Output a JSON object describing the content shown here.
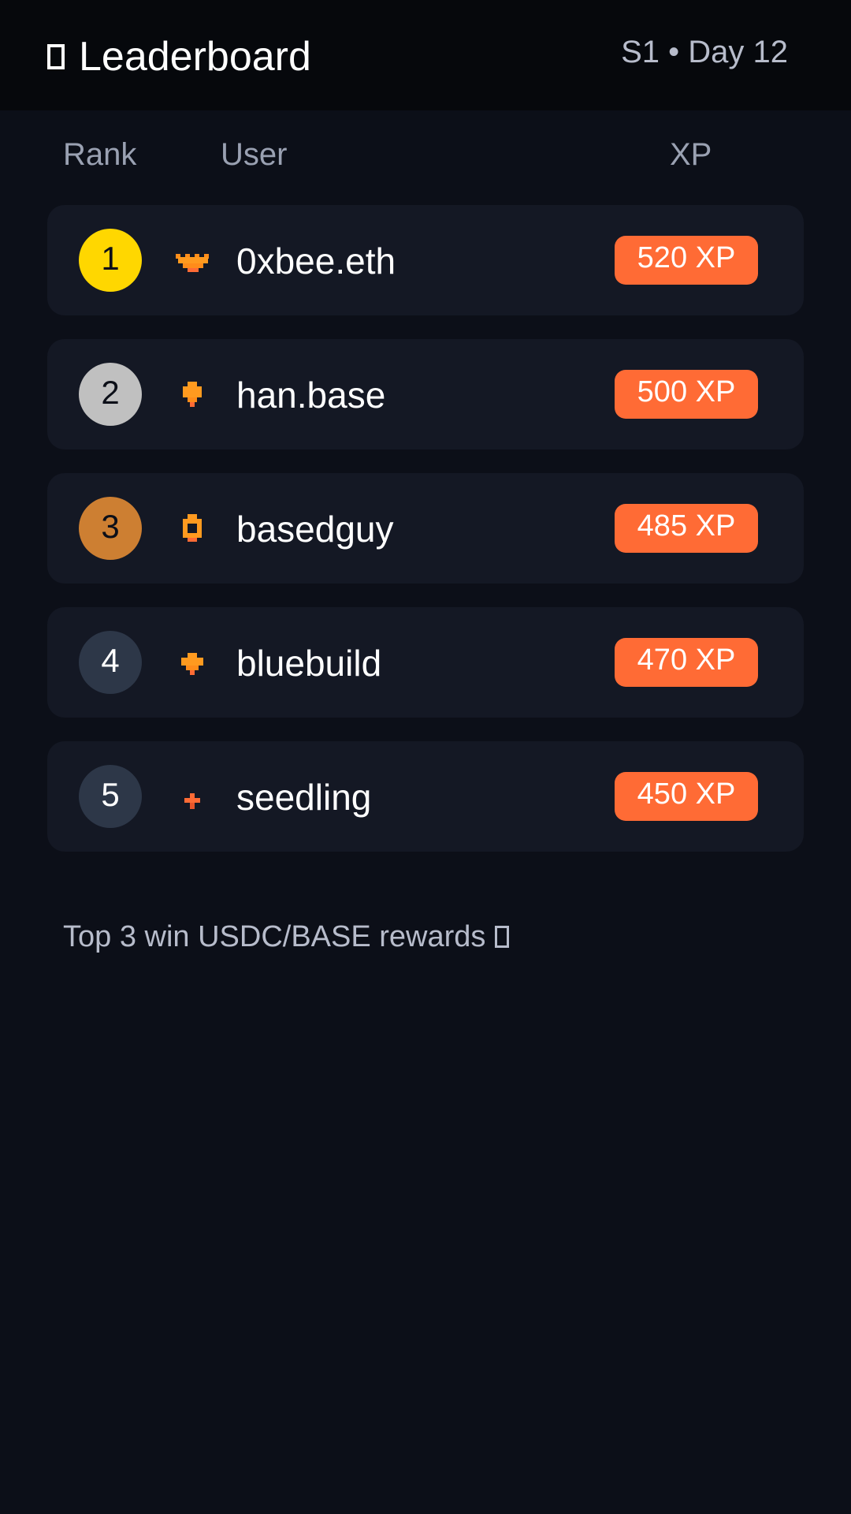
{
  "header": {
    "title": "Leaderboard",
    "title_icon": "trophy-icon",
    "season": "S1 • Day 12"
  },
  "columns": {
    "rank": "Rank",
    "user": "User",
    "xp": "XP"
  },
  "colors": {
    "accent": "#ff6b35",
    "gold": "#ffd700",
    "silver": "#c0c0c0",
    "bronze": "#cd7f32",
    "neutral_rank": "#2d3748"
  },
  "rows": [
    {
      "rank": "1",
      "avatar_icon": "crown-icon",
      "username": "0xbee.eth",
      "xp": "520 XP"
    },
    {
      "rank": "2",
      "avatar_icon": "diamond-icon",
      "username": "han.base",
      "xp": "500 XP"
    },
    {
      "rank": "3",
      "avatar_icon": "ring-icon",
      "username": "basedguy",
      "xp": "485 XP"
    },
    {
      "rank": "4",
      "avatar_icon": "gem-icon",
      "username": "bluebuild",
      "xp": "470 XP"
    },
    {
      "rank": "5",
      "avatar_icon": "sprout-icon",
      "username": "seedling",
      "xp": "450 XP"
    }
  ],
  "footer": {
    "note": "Top 3 win USDC/BASE rewards",
    "note_icon": "gift-icon"
  }
}
